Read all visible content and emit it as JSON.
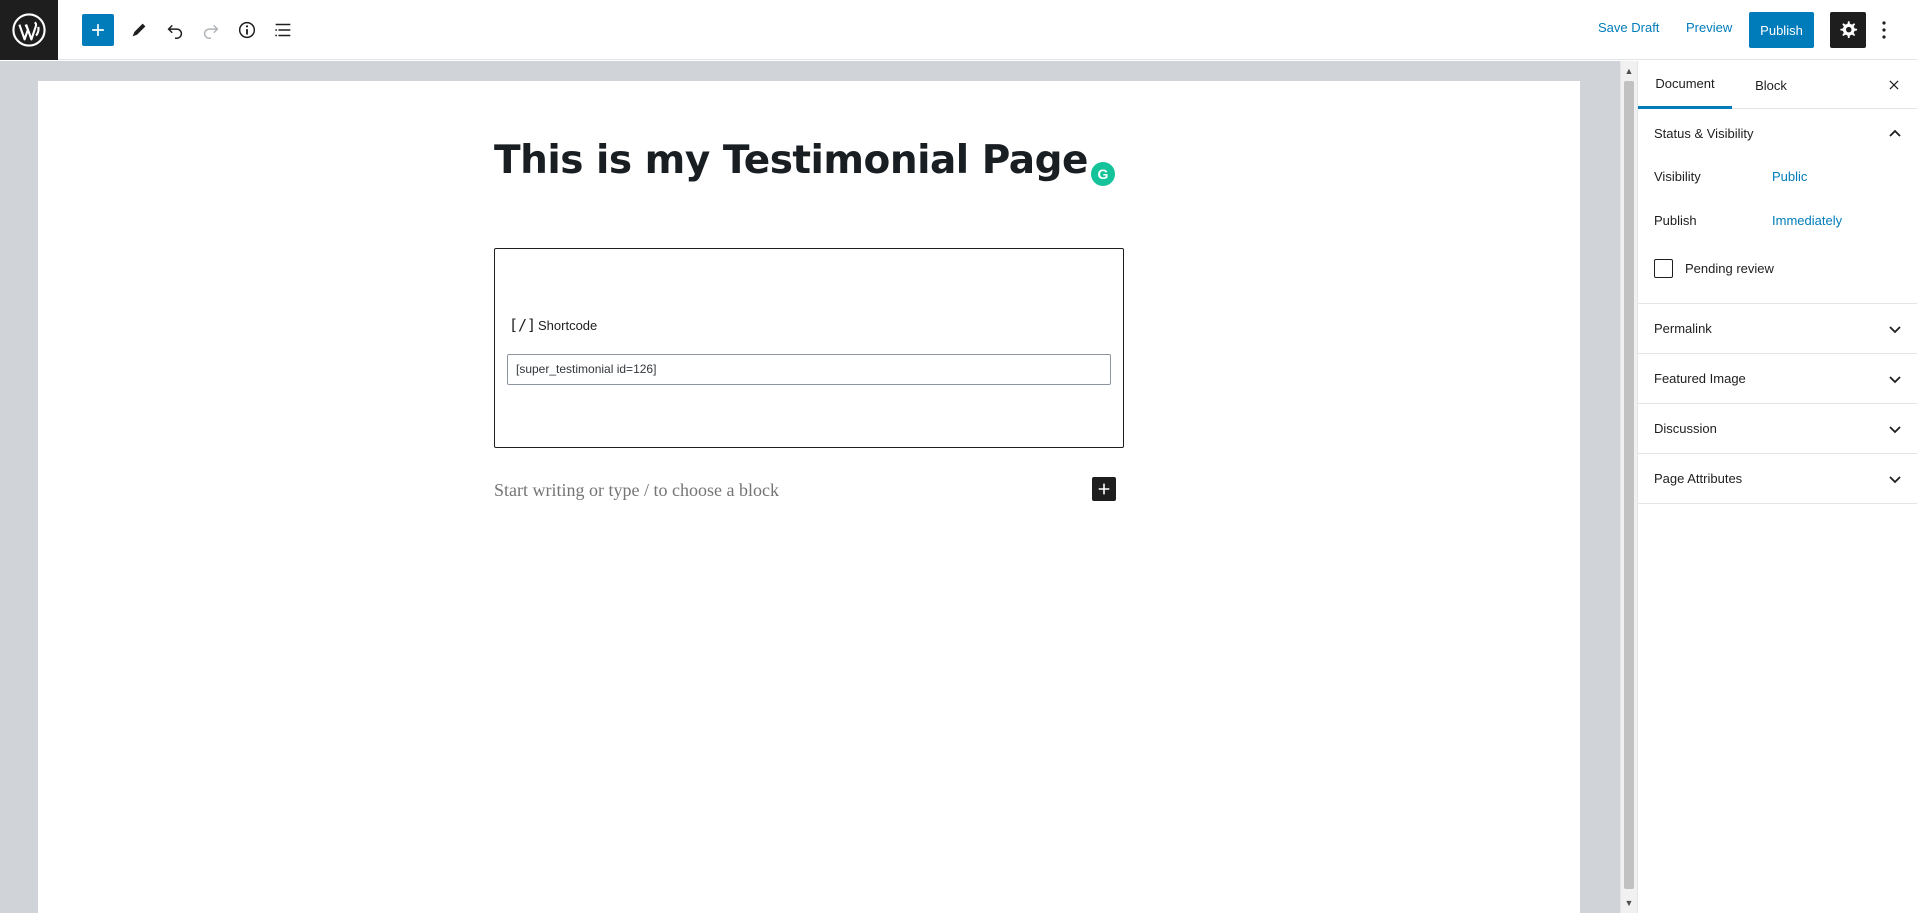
{
  "toolbar": {
    "save_draft_label": "Save Draft",
    "preview_label": "Preview",
    "publish_label": "Publish",
    "icons": [
      "wordpress-logo-icon",
      "plus-icon",
      "pencil-icon",
      "undo-icon",
      "redo-icon",
      "info-icon",
      "list-view-icon",
      "gear-icon",
      "more-vertical-icon"
    ],
    "accent_color": "#007cba"
  },
  "editor": {
    "title": "This is my Testimonial Page",
    "shortcode_block": {
      "icon_glyph": "[/]",
      "label": "Shortcode",
      "value": "[super_testimonial id=126]"
    },
    "appender_placeholder": "Start writing or type / to choose a block"
  },
  "sidebar": {
    "tabs": [
      {
        "label": "Document",
        "active": true
      },
      {
        "label": "Block",
        "active": false
      }
    ],
    "status_visibility": {
      "title": "Status & Visibility",
      "visibility_label": "Visibility",
      "visibility_value": "Public",
      "publish_label": "Publish",
      "publish_value": "Immediately",
      "pending_review_label": "Pending review"
    },
    "panels": [
      {
        "title": "Permalink"
      },
      {
        "title": "Featured Image"
      },
      {
        "title": "Discussion"
      },
      {
        "title": "Page Attributes"
      }
    ]
  }
}
